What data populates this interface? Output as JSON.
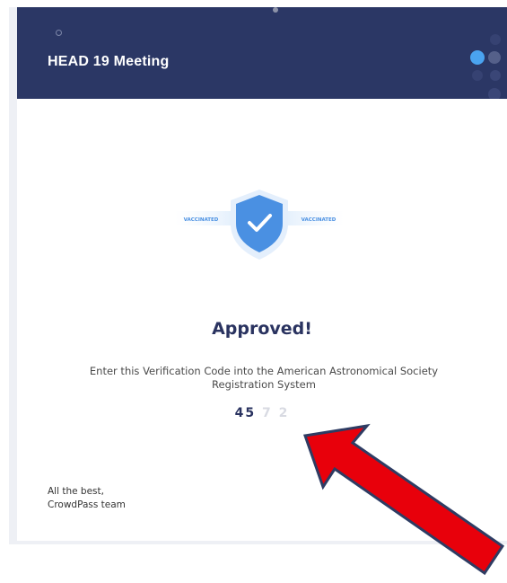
{
  "header": {
    "title": "HEAD 19 Meeting"
  },
  "badge": {
    "icon": "shield-check-icon",
    "left_label": "VACCINATED",
    "right_label": "VACCINATED",
    "shield_color": "#4a90e2"
  },
  "main": {
    "status_heading": "Approved!",
    "instruction_line1": "Enter this Verification Code into the American Astronomical Society",
    "instruction_line2": "Registration System",
    "verification_code": "45 7 2"
  },
  "footer": {
    "signoff_line1": "All the best,",
    "signoff_line2": "CrowdPass team"
  },
  "annotation": {
    "icon": "red-arrow-icon",
    "color": "#e8000b"
  },
  "colors": {
    "header_bg": "#2b3765",
    "heading": "#2a3360",
    "accent_blue": "#4a90e2"
  }
}
